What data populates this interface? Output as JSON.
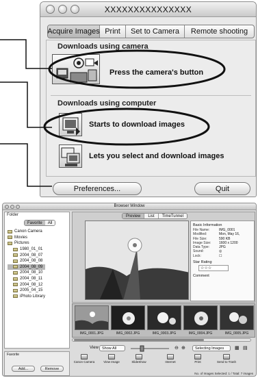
{
  "camera_window": {
    "title": "XXXXXXXXXXXXXXX",
    "tabs": [
      {
        "label": "Acquire Images",
        "active": true
      },
      {
        "label": "Print",
        "active": false
      },
      {
        "label": "Set to Camera",
        "active": false
      },
      {
        "label": "Remote shooting",
        "active": false
      }
    ],
    "sections": {
      "camera": "Downloads using camera",
      "computer": "Downloads using computer"
    },
    "actions": {
      "press_button": "Press the camera's button",
      "start_download": "Starts to download images",
      "select_download": "Lets you select and download images"
    },
    "buttons": {
      "preferences": "Preferences...",
      "quit": "Quit"
    }
  },
  "browser_window": {
    "title": "Browser Window",
    "folder_header": "Folder",
    "folder_tabs": [
      {
        "label": "Favorite",
        "active": true
      },
      {
        "label": "All",
        "active": false
      }
    ],
    "folders": [
      {
        "label": "Canon Camera",
        "selected": false
      },
      {
        "label": "Movies",
        "selected": false
      },
      {
        "label": "Pictures",
        "selected": false
      },
      {
        "label": "1980_01_01",
        "selected": false
      },
      {
        "label": "2004_08_07",
        "selected": false
      },
      {
        "label": "2004_08_08",
        "selected": false
      },
      {
        "label": "2004_08_09",
        "selected": true
      },
      {
        "label": "2004_08_10",
        "selected": false
      },
      {
        "label": "2004_08_11",
        "selected": false
      },
      {
        "label": "2004_08_12",
        "selected": false
      },
      {
        "label": "2005_04_15",
        "selected": false
      },
      {
        "label": "iPhoto Library",
        "selected": false
      }
    ],
    "favorite": {
      "header": "Favorite",
      "add": "Add...",
      "remove": "Remove"
    },
    "preview_tabs": [
      {
        "label": "Preview",
        "active": true
      },
      {
        "label": "List",
        "active": false
      },
      {
        "label": "TimeTunnel",
        "active": false
      }
    ],
    "info": {
      "section_basic": "Basic Information",
      "rows": [
        {
          "k": "File Name:",
          "v": "IMG_0001"
        },
        {
          "k": "Modified:",
          "v": "Mon, May 16,"
        },
        {
          "k": "File Size:",
          "v": "590 KB"
        },
        {
          "k": "Image Size:",
          "v": "1600 x 1200"
        },
        {
          "k": "Data Type:",
          "v": "JPG"
        },
        {
          "k": "Sound:",
          "v": ""
        },
        {
          "k": "Lock:",
          "v": ""
        }
      ],
      "section_rating": "Star Rating",
      "stars": "☆☆☆",
      "section_comment": "Comment"
    },
    "thumbnails": [
      {
        "label": "IMG_0001.JPG",
        "selected": true
      },
      {
        "label": "IMG_0002.JPG",
        "selected": false
      },
      {
        "label": "IMG_0003.JPG",
        "selected": false
      },
      {
        "label": "IMG_0004.JPG",
        "selected": false
      },
      {
        "label": "IMG_0005.JPG",
        "selected": false
      }
    ],
    "view_label": "View",
    "view_select": "Show All",
    "selecting_images": "Selecting Images",
    "toolbar": [
      {
        "label": "Canon Camera"
      },
      {
        "label": "View Image"
      },
      {
        "label": "SlideShow"
      },
      {
        "label": "Internet"
      },
      {
        "label": "Print"
      },
      {
        "label": "Send to Trash"
      }
    ],
    "status": "No. of Images Selected: 1 / Total: 7 images"
  }
}
